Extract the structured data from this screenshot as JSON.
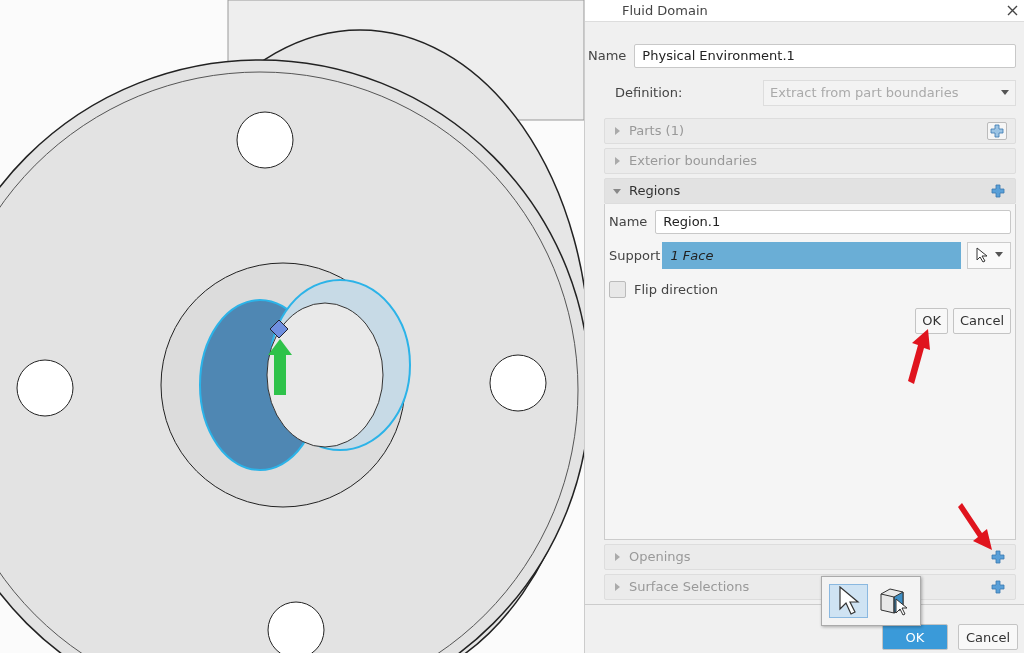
{
  "panel": {
    "title": "Fluid Domain",
    "name_label": "Name",
    "name_value": "Physical Environment.1",
    "definition_label": "Definition:",
    "definition_value": "Extract from part boundaries",
    "sections": [
      {
        "label": "Parts (1)",
        "expanded": false,
        "kind": "boxed"
      },
      {
        "label": "Exterior boundaries",
        "expanded": false,
        "kind": "bare"
      },
      {
        "label": "Regions",
        "expanded": true,
        "kind": "plain"
      }
    ],
    "region": {
      "name_label": "Name",
      "name_value": "Region.1",
      "support_label": "Support",
      "support_value": "1 Face",
      "flip_label": "Flip direction",
      "flip_checked": false,
      "ok": "OK",
      "cancel": "Cancel"
    },
    "lower_sections": [
      {
        "label": "Openings",
        "expanded": false,
        "kind": "plain"
      },
      {
        "label": "Surface Selections",
        "expanded": false,
        "kind": "plain"
      }
    ],
    "footer": {
      "ok": "OK",
      "cancel": "Cancel"
    }
  },
  "selection_popup": {
    "tools": [
      {
        "kind": "arrow",
        "selected": true
      },
      {
        "kind": "cube",
        "selected": false
      }
    ]
  }
}
